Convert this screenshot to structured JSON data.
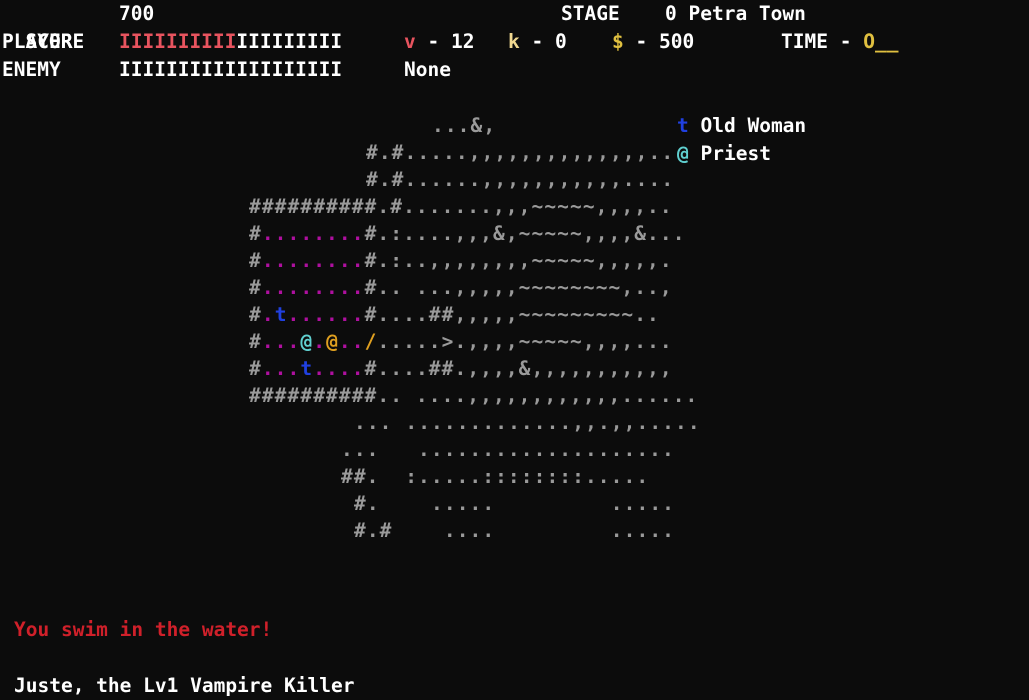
{
  "hud": {
    "score_label": "SCORE",
    "score_value": "700",
    "stage_label": "STAGE",
    "stage_value": "0 Petra Town",
    "player_label": "PLAYER",
    "player_bar_filled": "IIIIIIIIII",
    "player_bar_empty": "IIIIIIIII",
    "hearts_symbol": "v",
    "hearts_value": "12",
    "keys_symbol": "k",
    "keys_value": "0",
    "gold_symbol": "$",
    "gold_value": "500",
    "time_label": "TIME",
    "time_value": "O__",
    "enemy_label": "ENEMY",
    "enemy_bar": "IIIIIIIIIIIIIIIIIII",
    "enemy_name": "None",
    "dash": "-"
  },
  "legend": [
    {
      "glyph": "t",
      "name": "Old Woman",
      "color": "#2040e0"
    },
    {
      "glyph": "@",
      "name": "Priest",
      "color": "#60d0d0"
    }
  ],
  "map_rows": [
    [
      [
        "gray",
        "...&,"
      ]
    ],
    [
      [
        "gray",
        "#.#.....,,,,,,,,,,,,,,.."
      ]
    ],
    [
      [
        "gray",
        "#.#......,,,,,,,,,,,...."
      ]
    ],
    [
      [
        "gray",
        "##########.#.......,,,~~~~~,,,,.."
      ]
    ],
    [
      [
        "gray",
        "#"
      ],
      [
        "magenta",
        "........"
      ],
      [
        "gray",
        "#.:....,,,&,~~~~~,,,,&..."
      ]
    ],
    [
      [
        "gray",
        "#"
      ],
      [
        "magenta",
        "........"
      ],
      [
        "gray",
        "#.:..,,,,,,,,~~~~~,,,,,."
      ]
    ],
    [
      [
        "gray",
        "#"
      ],
      [
        "magenta",
        "........"
      ],
      [
        "gray",
        "#.. ...,,,,,~~~~~~~~,..,"
      ]
    ],
    [
      [
        "gray",
        "#"
      ],
      [
        "magenta",
        "."
      ],
      [
        "blue",
        "t"
      ],
      [
        "magenta",
        "......"
      ],
      [
        "gray",
        "#....##,,,,,~~~~~~~~~.."
      ]
    ],
    [
      [
        "gray",
        "#"
      ],
      [
        "magenta",
        "..."
      ],
      [
        "cyan",
        "@"
      ],
      [
        "magenta",
        "."
      ],
      [
        "orange",
        "@"
      ],
      [
        "magenta",
        ".."
      ],
      [
        "orange",
        "/"
      ],
      [
        "gray",
        ".....>.,,,,~~~~~,,,,..."
      ]
    ],
    [
      [
        "gray",
        "#"
      ],
      [
        "magenta",
        "..."
      ],
      [
        "blue",
        "t"
      ],
      [
        "magenta",
        "...."
      ],
      [
        "gray",
        "#....##.,,,,&,,,,,,,,,,,"
      ]
    ],
    [
      [
        "gray",
        "##########.. ....,,,,,,,,,,,,......"
      ]
    ],
    [
      [
        "gray",
        "... .............,,.,,....."
      ]
    ],
    [
      [
        "gray",
        "...   ...................."
      ]
    ],
    [
      [
        "gray",
        "##.  :.....::::::::....."
      ]
    ],
    [
      [
        "gray",
        "#.    .....         ....."
      ]
    ],
    [
      [
        "gray",
        "#.#    ....         ....."
      ]
    ]
  ],
  "message": "You swim in the water!",
  "status": "Juste, the Lv1 Vampire Killer"
}
